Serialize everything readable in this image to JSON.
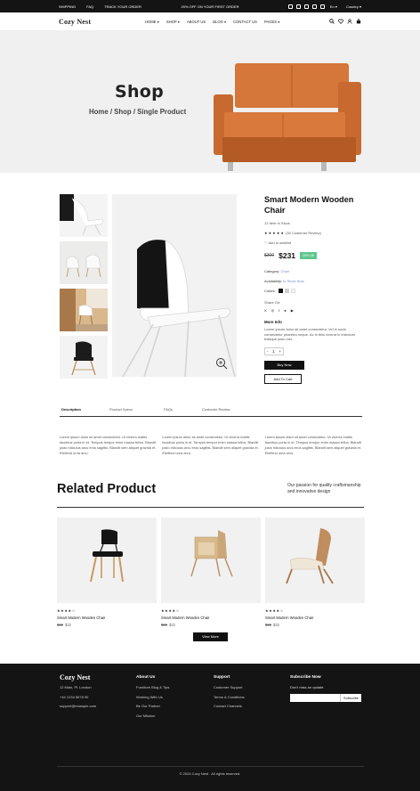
{
  "topbar": {
    "links": [
      "SHIPPING",
      "FAQ",
      "TRACK YOUR ORDER"
    ],
    "promo": "20% OFF ON YOUR FIRST ORDER",
    "language": "En",
    "country": "Country"
  },
  "nav": {
    "logo": "Cozy Nest",
    "menu": [
      "HOME",
      "SHOP",
      "ABOUT US",
      "BLOG",
      "CONTACT US",
      "PAGES"
    ]
  },
  "hero": {
    "title": "Shop",
    "breadcrumb": "Home / Shop / Single Product"
  },
  "product": {
    "title": "Smart Modern Wooden Chair",
    "stock": "12 Item In Stock",
    "reviews": "(30 Customer Review)",
    "rating": 5,
    "wishlist": "Add to wishlist",
    "old_price": "$300",
    "price": "$231",
    "discount": "30% Off",
    "category_label": "Category:",
    "category_value": "Chair",
    "availability_label": "Availability:",
    "availability_value": "In Stock Now",
    "colors_label": "Colors:",
    "colors": [
      "#111111",
      "#cfcfcf",
      "#f5f5f5"
    ],
    "share_label": "Share On:",
    "more_info_title": "More Info",
    "more_info_text": "Lorem ipsum dolor sit amet consectetur. Vel in socis consectetur pharetra neque. Ac in felis viverra in interdum tristique justo nisl.",
    "quantity": "1",
    "buy_now": "Buy Now",
    "add_to_cart": "Add To Cart"
  },
  "tabs": [
    "Description",
    "Product Specs",
    "FAQs",
    "Customer Review"
  ],
  "description": [
    "Lorem ipsum dolor sit amet consectetur. Ut viverra mattis faucibus porta in et. Tempus tempor enim massa tellus. Blandit justo ridiculus arcu eros sagittis. Blandit sem aliquet gravida et. Eleifend urna arcu.",
    "Lorem ipsum dolor sit amet consectetur. Ut viverra mattis faucibus porta in et. Tempus tempor enim massa tellus. Blandit justo ridiculus arcu eros sagittis. Blandit sem aliquet gravida et. Eleifend urna arcu.",
    "Lorem ipsum dolor sit amet consectetur. Ut viverra mattis faucibus porta in et. Tempus tempor enim massa tellus. Blandit justo ridiculus arcu eros sagittis. Blandit sem aliquet gravida et. Eleifend urna arcu."
  ],
  "related": {
    "title": "Related Product",
    "note": "Our passion for quality craftsmanship and innovative design",
    "products": [
      {
        "name": "Smart Modern Wooden Chair",
        "old_price": "$35",
        "price": "$32",
        "rating": 4
      },
      {
        "name": "Smart Modern Wooden Chair",
        "old_price": "$35",
        "price": "$32",
        "rating": 4
      },
      {
        "name": "Smart Modern Wooden Chair",
        "old_price": "$35",
        "price": "$32",
        "rating": 4
      }
    ],
    "view_more": "View More"
  },
  "footer": {
    "logo": "Cozy Nest",
    "address": "12 Main, Pl. London",
    "phone": "+44 1234 5678 90",
    "email": "support@example.com",
    "about_title": "About Us",
    "about_links": [
      "Furniture Blog & Tips",
      "Working With Us",
      "Be Our Partner",
      "Our Mission"
    ],
    "support_title": "Support",
    "support_links": [
      "Customer Support",
      "Terms & Conditions",
      "Contact Channels"
    ],
    "subscribe_title": "Subscribe Now",
    "subscribe_text": "Don't miss an update",
    "subscribe_button": "Subscribe",
    "copyright": "© 2024 Cozy Nest . All rights reserved."
  }
}
